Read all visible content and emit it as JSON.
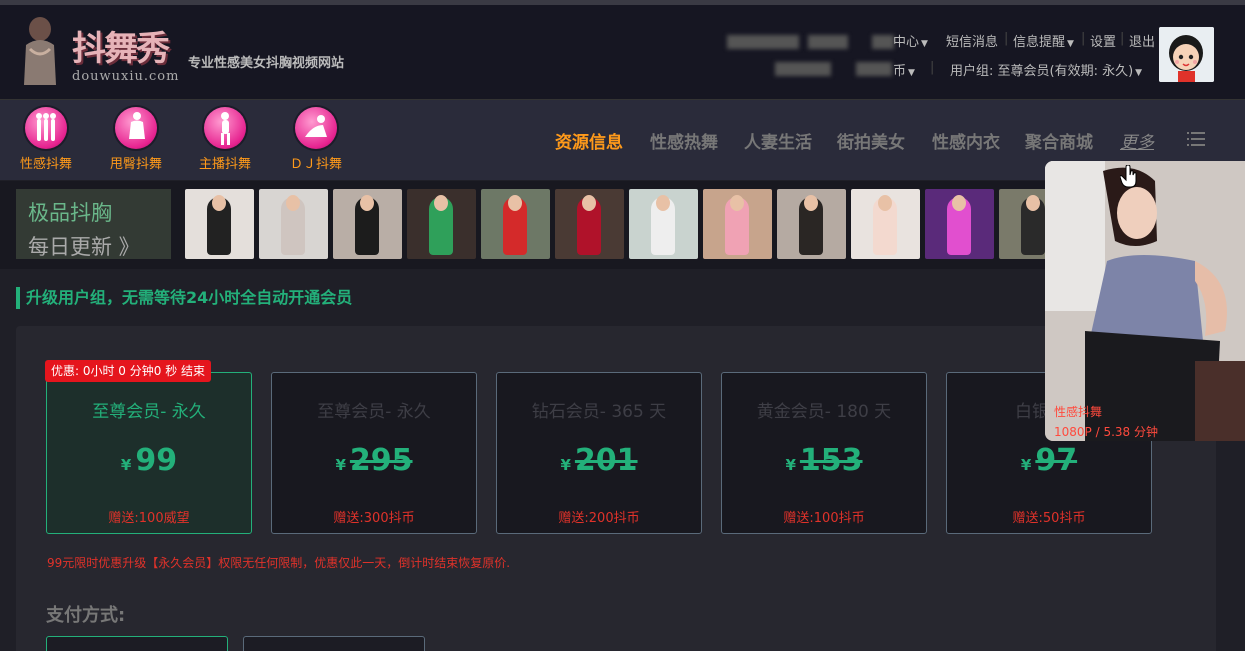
{
  "header": {
    "brand": "抖舞秀",
    "domain": "douwuxiu.com",
    "slogan": "专业性感美女抖胸视频网站",
    "user_nav": {
      "center": "中心",
      "messages": "短信消息",
      "alerts": "信息提醒",
      "settings": "设置",
      "logout": "退出",
      "coin": "币",
      "user_group": "用户组: 至尊会员(有效期: 永久)"
    }
  },
  "categories": [
    {
      "label": "性感抖舞"
    },
    {
      "label": "甩臀抖舞"
    },
    {
      "label": "主播抖舞"
    },
    {
      "label": "ＤＪ抖舞"
    }
  ],
  "main_nav": [
    "资源信息",
    "性感热舞",
    "人妻生活",
    "街拍美女",
    "性感内衣",
    "聚合商城",
    "更多"
  ],
  "promo": {
    "line1": "极品抖胸",
    "line2": "每日更新 》"
  },
  "section_title": "升级用户组，无需等待24小时全自动开通会员",
  "countdown": "优惠: 0小时 0 分钟0 秒 结束",
  "plans": [
    {
      "name": "至尊会员- 永久",
      "currency": "¥",
      "price": "99",
      "gift": "赠送:100威望"
    },
    {
      "name": "至尊会员- 永久",
      "currency": "¥",
      "price": "295",
      "gift": "赠送:300抖币"
    },
    {
      "name": "钻石会员- 365 天",
      "currency": "¥",
      "price": "201",
      "gift": "赠送:200抖币"
    },
    {
      "name": "黄金会员- 180 天",
      "currency": "¥",
      "price": "153",
      "gift": "赠送:100抖币"
    },
    {
      "name": "白银会员",
      "currency": "¥",
      "price": "97",
      "gift": "赠送:50抖币"
    }
  ],
  "notice": "99元限时优惠升级【永久会员】权限无任何限制，优惠仅此一天，倒计时结束恢复原价.",
  "payment_label": "支付方式:",
  "video_popup": {
    "title": "性感抖舞",
    "meta": "1080P / 5.38 分钟"
  },
  "colors": {
    "accent_green": "#23b07a",
    "accent_orange": "#ff9a1a",
    "alert_red": "#e0322a"
  },
  "icons": {
    "menu": "list-icon",
    "caret": "chevron-down-icon"
  }
}
